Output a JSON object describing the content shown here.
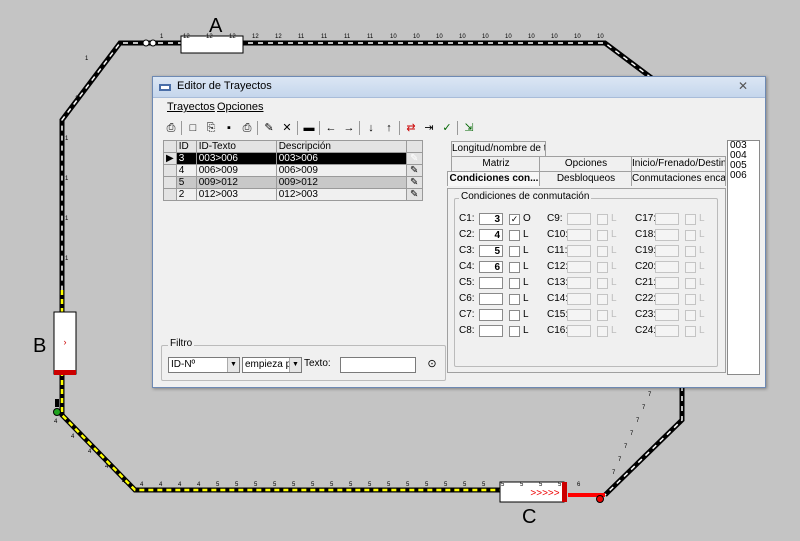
{
  "layout_labels": {
    "a": "A",
    "b": "B",
    "c": "C"
  },
  "top_track_numbers": [
    "1",
    "12",
    "12",
    "12",
    "12",
    "12",
    "11",
    "11",
    "11",
    "11",
    "10",
    "10",
    "10",
    "10",
    "10",
    "10",
    "10",
    "10",
    "10",
    "10"
  ],
  "left_track_numbers": [
    "1",
    "1",
    "1",
    "1",
    "1",
    "1"
  ],
  "bottom_track_numbers": [
    "4",
    "4",
    "4",
    "4",
    "5",
    "5",
    "5",
    "5",
    "5",
    "5",
    "5",
    "5",
    "5",
    "5",
    "5",
    "5",
    "5",
    "5",
    "5",
    "5",
    "5",
    "5",
    "5",
    "6"
  ],
  "right_track_numbers": [
    "7",
    "7",
    "7",
    "7",
    "7",
    "7",
    "7"
  ],
  "diag_numbers": [
    "4",
    "4",
    "4",
    "4",
    "4"
  ],
  "window": {
    "title": "Editor de Trayectos",
    "close_glyph": "✕",
    "menu": [
      "Trayectos",
      "Opciones"
    ]
  },
  "grid": {
    "columns": [
      "ID",
      "ID-Texto",
      "Descripción"
    ],
    "rows": [
      {
        "id": "3",
        "text": "003>006",
        "desc": "003>006",
        "selected": true
      },
      {
        "id": "4",
        "text": "006>009",
        "desc": "006>009",
        "selected": false
      },
      {
        "id": "5",
        "text": "009>012",
        "desc": "009>012",
        "selected": false
      },
      {
        "id": "2",
        "text": "012>003",
        "desc": "012>003",
        "selected": false
      }
    ]
  },
  "filter": {
    "legend": "Filtro",
    "field": "ID-Nº",
    "mode": "empieza por",
    "text_label": "Texto:",
    "text_value": ""
  },
  "tabs": {
    "row1": [
      "Longitud/nombre de t..."
    ],
    "row2": [
      "Matriz",
      "Opciones",
      "Inicio/Frenado/Destino"
    ],
    "row3": [
      "Condiciones con...",
      "Desbloqueos",
      "Conmutaciones enca..."
    ]
  },
  "conditions": {
    "legend": "Condiciones de conmutación",
    "col1": [
      {
        "label": "C1:",
        "value": "3",
        "checked": true,
        "letter": "O"
      },
      {
        "label": "C2:",
        "value": "4",
        "checked": false,
        "letter": "L"
      },
      {
        "label": "C3:",
        "value": "5",
        "checked": false,
        "letter": "L"
      },
      {
        "label": "C4:",
        "value": "6",
        "checked": false,
        "letter": "L"
      },
      {
        "label": "C5:",
        "value": "",
        "checked": false,
        "letter": "L"
      },
      {
        "label": "C6:",
        "value": "",
        "checked": false,
        "letter": "L"
      },
      {
        "label": "C7:",
        "value": "",
        "checked": false,
        "letter": "L"
      },
      {
        "label": "C8:",
        "value": "",
        "checked": false,
        "letter": "L"
      }
    ],
    "col2_labels": [
      "C9:",
      "C10:",
      "C11:",
      "C12:",
      "C13:",
      "C14:",
      "C15:",
      "C16:"
    ],
    "col3_labels": [
      "C17:",
      "C18:",
      "C19:",
      "C20:",
      "C21:",
      "C22:",
      "C23:",
      "C24:"
    ],
    "disabled_letter": "L"
  },
  "right_list": [
    "003",
    "004",
    "005",
    "006"
  ],
  "colors": {
    "accent": "#d8e4f3",
    "track_black": "#000000",
    "track_yellow": "#ffff00",
    "route_red": "#ff0000"
  }
}
